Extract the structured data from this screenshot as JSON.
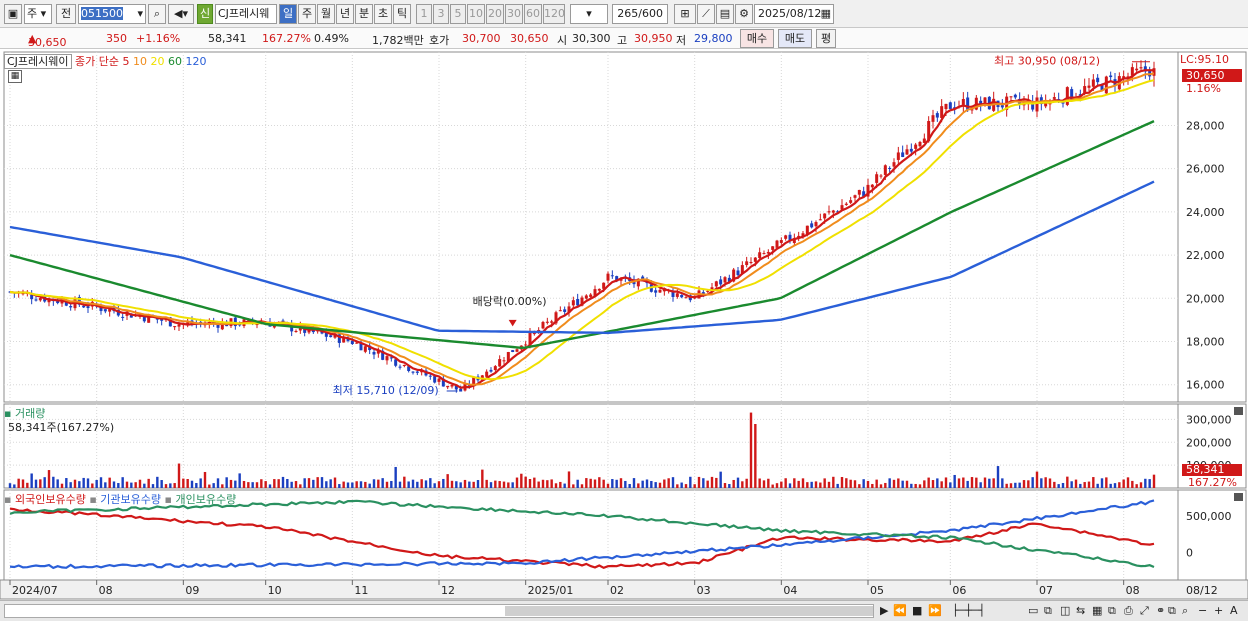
{
  "toolbar": {
    "period_mode": "주",
    "prev_label": "전",
    "code": "051500",
    "new_badge": "신",
    "stock_name": "CJ프레시웨",
    "period_tabs": [
      "일",
      "주",
      "월",
      "년",
      "분",
      "초",
      "틱"
    ],
    "minute_options": [
      "1",
      "3",
      "5",
      "10",
      "20",
      "30",
      "60",
      "120"
    ],
    "count_current": "265",
    "count_total": "/600",
    "date": "2025/08/12"
  },
  "quote": {
    "price": "30,650",
    "change": "350",
    "change_pct": "+1.16%",
    "volume": "58,341",
    "volume_ratio": "167.27%",
    "turnover": "0.49%",
    "amount": "1,782백만",
    "hoga_label": "호가",
    "ask": "30,700",
    "bid": "30,650",
    "open_label": "시",
    "open": "30,300",
    "high_label": "고",
    "high": "30,950",
    "low_label": "저",
    "low": "29,800",
    "buy_label": "매수",
    "sell_label": "매도",
    "avg_label": "평"
  },
  "price_panel": {
    "legend_name": "CJ프레시웨이",
    "legend_ma_label": "종가 단순",
    "ma_periods": [
      "5",
      "10",
      "20",
      "60",
      "120"
    ],
    "ma_colors": [
      "#d01818",
      "#f08c1c",
      "#f0e000",
      "#1a8a2e",
      "#2a5fd8"
    ],
    "lc_label": "LC:95.10",
    "current_tag": "30,650",
    "current_pct": "1.16%",
    "high_annot": "최고 30,950 (08/12)",
    "low_annot": "최저 15,710 (12/09)",
    "event_annot": "배당락(0.00%)",
    "y_ticks": [
      "28,000",
      "26,000",
      "24,000",
      "22,000",
      "20,000",
      "18,000",
      "16,000"
    ]
  },
  "volume_panel": {
    "title": "거래량",
    "info": "58,341주(167.27%)",
    "y_ticks": [
      "300,000",
      "200,000",
      "100,000"
    ],
    "current_tag": "58,341",
    "current_pct": "167.27%"
  },
  "holding_panel": {
    "legend": [
      {
        "label": "외국인보유수량",
        "color": "#d01818"
      },
      {
        "label": "기관보유수량",
        "color": "#2a5fd8"
      },
      {
        "label": "개인보유수량",
        "color": "#2a9060"
      }
    ],
    "y_ticks": [
      "500,000",
      "0"
    ]
  },
  "x_axis": {
    "labels": [
      "2024/07",
      "08",
      "09",
      "10",
      "11",
      "12",
      "2025/01",
      "02",
      "03",
      "04",
      "05",
      "06",
      "07",
      "08"
    ],
    "right_label": "08/12"
  },
  "colors": {
    "up": "#d01818",
    "down": "#1a3fc0",
    "grid": "#c8c8c8"
  },
  "chart_data": {
    "type": "candlestick",
    "period": "daily",
    "start_date": "2024-07",
    "end_date": "2025-08-12",
    "price_range": [
      15200,
      31400
    ],
    "price_anchors": [
      {
        "date": "2024-07",
        "close": 20300
      },
      {
        "date": "2024-08",
        "close": 19600
      },
      {
        "date": "2024-09",
        "close": 18800
      },
      {
        "date": "2024-10",
        "close": 18900
      },
      {
        "date": "2024-11",
        "close": 18000
      },
      {
        "date": "2024-12-09",
        "close": 15710
      },
      {
        "date": "2025-01",
        "close": 18000
      },
      {
        "date": "2025-02",
        "close": 21000
      },
      {
        "date": "2025-03",
        "close": 20000
      },
      {
        "date": "2025-04",
        "close": 22500
      },
      {
        "date": "2025-05",
        "close": 25000
      },
      {
        "date": "2025-06",
        "close": 29000
      },
      {
        "date": "2025-07",
        "close": 29000
      },
      {
        "date": "2025-08-12",
        "close": 30650
      }
    ],
    "last_ohlc": {
      "open": 30300,
      "high": 30950,
      "low": 29800,
      "close": 30650
    },
    "ma120_anchors": [
      {
        "date": "2024-07",
        "value": 23300
      },
      {
        "date": "2024-09",
        "value": 21900
      },
      {
        "date": "2024-12",
        "value": 18500
      },
      {
        "date": "2025-02",
        "value": 18400
      },
      {
        "date": "2025-04",
        "value": 19000
      },
      {
        "date": "2025-06",
        "value": 21000
      },
      {
        "date": "2025-08-12",
        "value": 25400
      }
    ],
    "ma60_anchors": [
      {
        "date": "2024-07",
        "value": 22000
      },
      {
        "date": "2024-10",
        "value": 18800
      },
      {
        "date": "2025-01",
        "value": 17700
      },
      {
        "date": "2025-04",
        "value": 20000
      },
      {
        "date": "2025-06",
        "value": 24000
      },
      {
        "date": "2025-08-12",
        "value": 28200
      }
    ],
    "volume_range": [
      0,
      350000
    ],
    "volume_spikes": [
      {
        "date": "2025-03",
        "value": 330000
      },
      {
        "date": "2025-03",
        "value": 280000
      }
    ],
    "last_volume": 58341,
    "holdings": {
      "foreign": [
        {
          "date": "2024-07",
          "value": 600000
        },
        {
          "date": "2024-10",
          "value": 350000
        },
        {
          "date": "2024-12",
          "value": -50000
        },
        {
          "date": "2025-02",
          "value": -200000
        },
        {
          "date": "2025-03",
          "value": -150000
        },
        {
          "date": "2025-04",
          "value": 200000
        },
        {
          "date": "2025-06",
          "value": 150000
        },
        {
          "date": "2025-07",
          "value": 400000
        },
        {
          "date": "2025-08-12",
          "value": 100000
        }
      ],
      "institution": [
        {
          "date": "2024-07",
          "value": -200000
        },
        {
          "date": "2025-01",
          "value": -150000
        },
        {
          "date": "2025-04",
          "value": 100000
        },
        {
          "date": "2025-06",
          "value": 300000
        },
        {
          "date": "2025-08-12",
          "value": 700000
        }
      ],
      "individual": [
        {
          "date": "2024-07",
          "value": 550000
        },
        {
          "date": "2024-11",
          "value": 700000
        },
        {
          "date": "2025-02",
          "value": 500000
        },
        {
          "date": "2025-04",
          "value": 300000
        },
        {
          "date": "2025-06",
          "value": 200000
        },
        {
          "date": "2025-08-12",
          "value": -200000
        }
      ]
    }
  }
}
